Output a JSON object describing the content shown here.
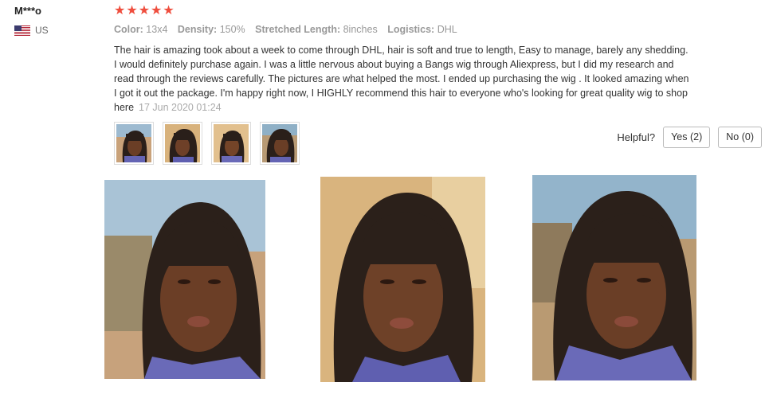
{
  "reviewer": {
    "name": "M***o",
    "country": "US",
    "flag_icon": "us-flag-icon"
  },
  "rating": {
    "stars": 5,
    "max": 5,
    "color": "#ef4e3e"
  },
  "attributes": [
    {
      "key": "Color:",
      "value": "13x4"
    },
    {
      "key": "Density:",
      "value": "150%"
    },
    {
      "key": "Stretched Length:",
      "value": "8inches"
    },
    {
      "key": "Logistics:",
      "value": "DHL"
    }
  ],
  "review": {
    "text": "The hair is amazing took about a week to come through DHL, hair is soft and true to length, Easy to manage, barely any shedding. I would definitely purchase again. I was a little nervous about buying a Bangs wig through Aliexpress, but I did my research and read through the reviews carefully. The pictures are what helped the most. I ended up purchasing the wig . It looked amazing when I got it out the package. I'm happy right now, I HIGHLY recommend this hair to everyone who's looking for great quality wig to shop here",
    "date": "17 Jun 2020 01:24"
  },
  "helpful": {
    "label": "Helpful?",
    "yes_label": "Yes (2)",
    "no_label": "No (0)"
  }
}
